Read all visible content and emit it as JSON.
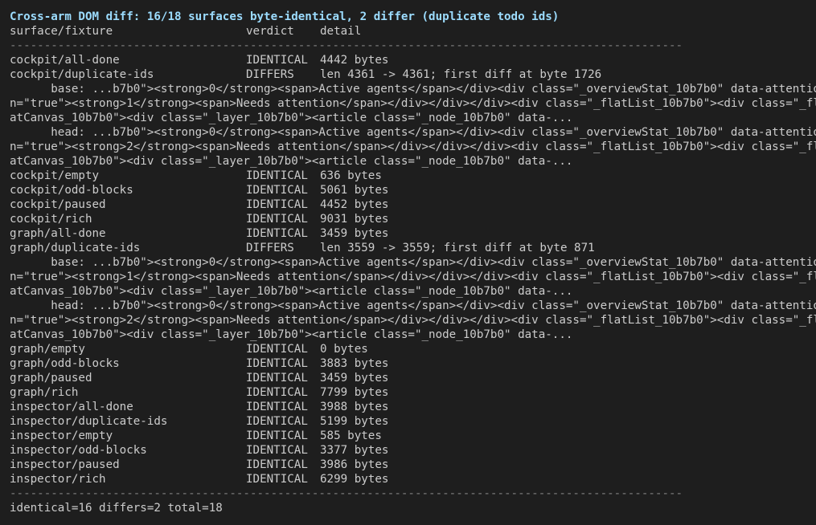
{
  "title": "Cross-arm DOM diff: 16/18 surfaces byte-identical, 2 differ (duplicate todo ids)",
  "header": {
    "col1": "surface/fixture",
    "col2": "verdict",
    "col3": "detail"
  },
  "rule": "--------------------------------------------------------------------------------------------------",
  "rows": [
    {
      "surface": "cockpit/all-done",
      "verdict": "IDENTICAL",
      "detail": "4442 bytes"
    },
    {
      "surface": "cockpit/duplicate-ids",
      "verdict": "DIFFERS",
      "detail": "len 4361 -> 4361; first diff at byte 1726",
      "diff_lines": [
        "      base: ...b7b0\"><strong>0</strong><span>Active agents</span></div><div class=\"_overviewStat_10b7b0\" data-attentio",
        "n=\"true\"><strong>1</strong><span>Needs attention</span></div></div></div><div class=\"_flatList_10b7b0\"><div class=\"_fl",
        "atCanvas_10b7b0\"><div class=\"_layer_10b7b0\"><article class=\"_node_10b7b0\" data-...",
        "      head: ...b7b0\"><strong>0</strong><span>Active agents</span></div><div class=\"_overviewStat_10b7b0\" data-attentio",
        "n=\"true\"><strong>2</strong><span>Needs attention</span></div></div></div><div class=\"_flatList_10b7b0\"><div class=\"_fl",
        "atCanvas_10b7b0\"><div class=\"_layer_10b7b0\"><article class=\"_node_10b7b0\" data-..."
      ]
    },
    {
      "surface": "cockpit/empty",
      "verdict": "IDENTICAL",
      "detail": "636 bytes"
    },
    {
      "surface": "cockpit/odd-blocks",
      "verdict": "IDENTICAL",
      "detail": "5061 bytes"
    },
    {
      "surface": "cockpit/paused",
      "verdict": "IDENTICAL",
      "detail": "4452 bytes"
    },
    {
      "surface": "cockpit/rich",
      "verdict": "IDENTICAL",
      "detail": "9031 bytes"
    },
    {
      "surface": "graph/all-done",
      "verdict": "IDENTICAL",
      "detail": "3459 bytes"
    },
    {
      "surface": "graph/duplicate-ids",
      "verdict": "DIFFERS",
      "detail": "len 3559 -> 3559; first diff at byte 871",
      "diff_lines": [
        "      base: ...b7b0\"><strong>0</strong><span>Active agents</span></div><div class=\"_overviewStat_10b7b0\" data-attentio",
        "n=\"true\"><strong>1</strong><span>Needs attention</span></div></div></div><div class=\"_flatList_10b7b0\"><div class=\"_fl",
        "atCanvas_10b7b0\"><div class=\"_layer_10b7b0\"><article class=\"_node_10b7b0\" data-...",
        "      head: ...b7b0\"><strong>0</strong><span>Active agents</span></div><div class=\"_overviewStat_10b7b0\" data-attentio",
        "n=\"true\"><strong>2</strong><span>Needs attention</span></div></div></div><div class=\"_flatList_10b7b0\"><div class=\"_fl",
        "atCanvas_10b7b0\"><div class=\"_layer_10b7b0\"><article class=\"_node_10b7b0\" data-..."
      ]
    },
    {
      "surface": "graph/empty",
      "verdict": "IDENTICAL",
      "detail": "0 bytes"
    },
    {
      "surface": "graph/odd-blocks",
      "verdict": "IDENTICAL",
      "detail": "3883 bytes"
    },
    {
      "surface": "graph/paused",
      "verdict": "IDENTICAL",
      "detail": "3459 bytes"
    },
    {
      "surface": "graph/rich",
      "verdict": "IDENTICAL",
      "detail": "7799 bytes"
    },
    {
      "surface": "inspector/all-done",
      "verdict": "IDENTICAL",
      "detail": "3988 bytes"
    },
    {
      "surface": "inspector/duplicate-ids",
      "verdict": "IDENTICAL",
      "detail": "5199 bytes"
    },
    {
      "surface": "inspector/empty",
      "verdict": "IDENTICAL",
      "detail": "585 bytes"
    },
    {
      "surface": "inspector/odd-blocks",
      "verdict": "IDENTICAL",
      "detail": "3377 bytes"
    },
    {
      "surface": "inspector/paused",
      "verdict": "IDENTICAL",
      "detail": "3986 bytes"
    },
    {
      "surface": "inspector/rich",
      "verdict": "IDENTICAL",
      "detail": "6299 bytes"
    }
  ],
  "summary": "identical=16 differs=2 total=18",
  "colors": {
    "background": "#1e1e1e",
    "text": "#cccccc",
    "title": "#9cdcfe",
    "rule": "#808080"
  }
}
